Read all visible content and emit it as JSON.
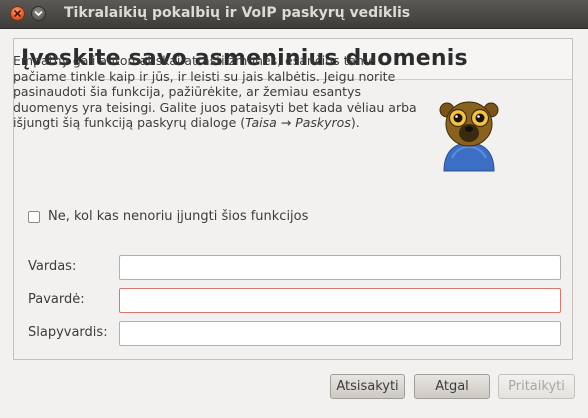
{
  "window": {
    "title": "Tikralaikių pokalbių ir VoIP paskyrų vediklis"
  },
  "page": {
    "heading": "Įveskite savo asmeninius duomenis",
    "description_main": "Empathy gali automatiškai atrasti žmones, esančius tame pačiame tinkle kaip ir jūs, ir leisti su jais kalbėtis. Jeigu norite pasinaudoti šia funkcija, pažiūrėkite, ar žemiau esantys duomenys yra teisingi. Galite juos pataisyti bet kada vėliau arba išjungti šią funkciją paskyrų dialoge (",
    "description_menu_path": "Taisa → Paskyros",
    "description_end": ").",
    "avatar_icon": "avatar-icon",
    "checkbox": {
      "label": "Ne, kol kas nenoriu įjungti šios funkcijos",
      "checked": false
    }
  },
  "form": {
    "fields": [
      {
        "label": "Vardas:",
        "value": ""
      },
      {
        "label": "Pavardė:",
        "value": ""
      },
      {
        "label": "Slapyvardis:",
        "value": ""
      }
    ]
  },
  "buttons": {
    "cancel": "Atsisakyti",
    "back": "Atgal",
    "apply": "Pritaikyti"
  },
  "colors": {
    "titlebar": "#3d3c38",
    "close_button": "#e2511f",
    "error_border": "#d9776f"
  }
}
